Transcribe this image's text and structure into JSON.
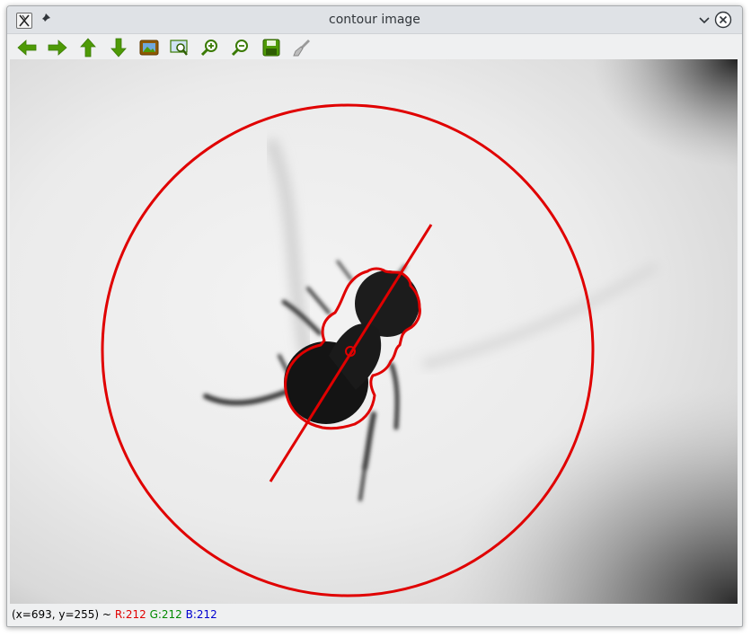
{
  "window": {
    "title": "contour image"
  },
  "titlebar": {
    "app_icon": "x11-app-icon",
    "pin_icon": "pin-icon",
    "minimize_icon": "chevron-down-icon",
    "close_icon": "close-icon"
  },
  "toolbar": {
    "buttons": [
      {
        "icon": "arrow-left-icon"
      },
      {
        "icon": "arrow-right-icon"
      },
      {
        "icon": "arrow-up-icon"
      },
      {
        "icon": "arrow-down-icon"
      },
      {
        "icon": "image-icon"
      },
      {
        "icon": "zoom-region-icon"
      },
      {
        "icon": "zoom-in-icon"
      },
      {
        "icon": "zoom-out-icon"
      },
      {
        "icon": "save-icon"
      },
      {
        "icon": "brush-icon"
      }
    ],
    "icon_color": "#4e9a06"
  },
  "image": {
    "overlay_color": "#e00000"
  },
  "status": {
    "coords": "(x=693, y=255) ~",
    "r": "R:212",
    "g": "G:212",
    "b": "B:212"
  }
}
